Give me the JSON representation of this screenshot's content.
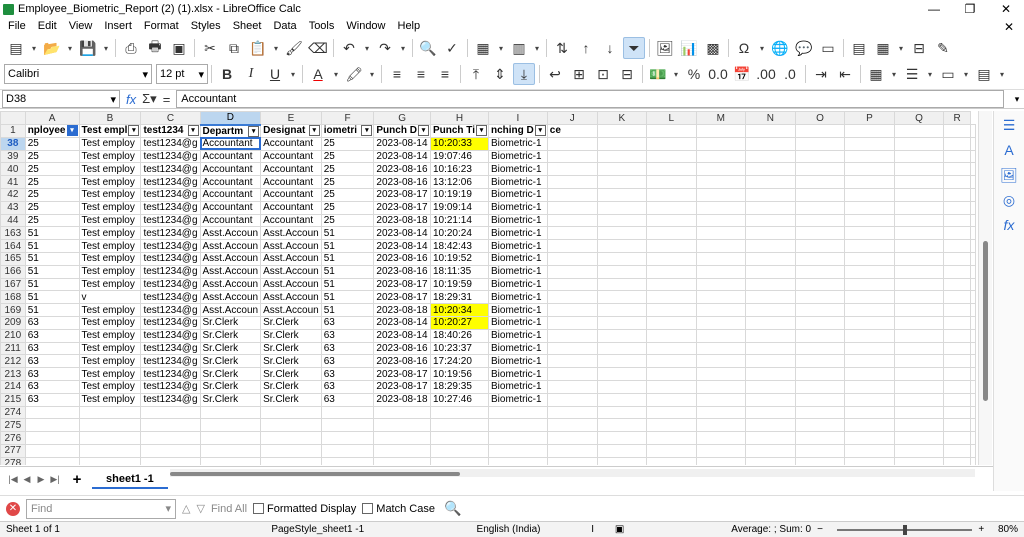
{
  "window": {
    "title": "Employee_Biometric_Report (2) (1).xlsx - LibreOffice Calc"
  },
  "menu": [
    "File",
    "Edit",
    "View",
    "Insert",
    "Format",
    "Styles",
    "Sheet",
    "Data",
    "Tools",
    "Window",
    "Help"
  ],
  "format": {
    "font_name": "Calibri",
    "font_size": "12 pt"
  },
  "formula": {
    "cell_ref": "D38",
    "content": "Accountant"
  },
  "columns": [
    "A",
    "B",
    "C",
    "D",
    "E",
    "F",
    "G",
    "H",
    "I",
    "J",
    "K",
    "L",
    "M",
    "N",
    "O",
    "P",
    "Q",
    "R"
  ],
  "selected_column": "D",
  "header_row": {
    "row_num": "1",
    "cells": [
      "nployee",
      "Test empl",
      "test1234",
      "Departm",
      "Designat",
      "iometri",
      "Punch D",
      "Punch Ti",
      "nching D",
      "ce",
      "",
      "",
      "",
      "",
      "",
      "",
      "",
      ""
    ]
  },
  "rows": [
    {
      "num": "38",
      "cells": [
        "25",
        "Test employ",
        "test1234@g",
        "Accountant",
        "Accountant",
        "25",
        "2023-08-14",
        "10:20:33",
        "Biometric-1"
      ]
    },
    {
      "num": "39",
      "cells": [
        "25",
        "Test employ",
        "test1234@g",
        "Accountant",
        "Accountant",
        "25",
        "2023-08-14",
        "19:07:46",
        "Biometric-1"
      ]
    },
    {
      "num": "40",
      "cells": [
        "25",
        "Test employ",
        "test1234@g",
        "Accountant",
        "Accountant",
        "25",
        "2023-08-16",
        "10:16:23",
        "Biometric-1"
      ]
    },
    {
      "num": "41",
      "cells": [
        "25",
        "Test employ",
        "test1234@g",
        "Accountant",
        "Accountant",
        "25",
        "2023-08-16",
        "13:12:06",
        "Biometric-1"
      ]
    },
    {
      "num": "42",
      "cells": [
        "25",
        "Test employ",
        "test1234@g",
        "Accountant",
        "Accountant",
        "25",
        "2023-08-17",
        "10:19:19",
        "Biometric-1"
      ]
    },
    {
      "num": "43",
      "cells": [
        "25",
        "Test employ",
        "test1234@g",
        "Accountant",
        "Accountant",
        "25",
        "2023-08-17",
        "19:09:14",
        "Biometric-1"
      ]
    },
    {
      "num": "44",
      "cells": [
        "25",
        "Test employ",
        "test1234@g",
        "Accountant",
        "Accountant",
        "25",
        "2023-08-18",
        "10:21:14",
        "Biometric-1"
      ]
    },
    {
      "num": "163",
      "cells": [
        "51",
        "Test employ",
        "test1234@g",
        "Asst.Accoun",
        "Asst.Accoun",
        "51",
        "2023-08-14",
        "10:20:24",
        "Biometric-1"
      ]
    },
    {
      "num": "164",
      "cells": [
        "51",
        "Test employ",
        "test1234@g",
        "Asst.Accoun",
        "Asst.Accoun",
        "51",
        "2023-08-14",
        "18:42:43",
        "Biometric-1"
      ]
    },
    {
      "num": "165",
      "cells": [
        "51",
        "Test employ",
        "test1234@g",
        "Asst.Accoun",
        "Asst.Accoun",
        "51",
        "2023-08-16",
        "10:19:52",
        "Biometric-1"
      ]
    },
    {
      "num": "166",
      "cells": [
        "51",
        "Test employ",
        "test1234@g",
        "Asst.Accoun",
        "Asst.Accoun",
        "51",
        "2023-08-16",
        "18:11:35",
        "Biometric-1"
      ]
    },
    {
      "num": "167",
      "cells": [
        "51",
        "Test employ",
        "test1234@g",
        "Asst.Accoun",
        "Asst.Accoun",
        "51",
        "2023-08-17",
        "10:19:59",
        "Biometric-1"
      ]
    },
    {
      "num": "168",
      "cells": [
        "51",
        "v",
        "test1234@g",
        "Asst.Accoun",
        "Asst.Accoun",
        "51",
        "2023-08-17",
        "18:29:31",
        "Biometric-1"
      ]
    },
    {
      "num": "169",
      "cells": [
        "51",
        "Test employ",
        "test1234@g",
        "Asst.Accoun",
        "Asst.Accoun",
        "51",
        "2023-08-18",
        "10:20:34",
        "Biometric-1"
      ]
    },
    {
      "num": "209",
      "cells": [
        "63",
        "Test employ",
        "test1234@g",
        "Sr.Clerk",
        "Sr.Clerk",
        "63",
        "2023-08-14",
        "10:20:27",
        "Biometric-1"
      ]
    },
    {
      "num": "210",
      "cells": [
        "63",
        "Test employ",
        "test1234@g",
        "Sr.Clerk",
        "Sr.Clerk",
        "63",
        "2023-08-14",
        "18:40:26",
        "Biometric-1"
      ]
    },
    {
      "num": "211",
      "cells": [
        "63",
        "Test employ",
        "test1234@g",
        "Sr.Clerk",
        "Sr.Clerk",
        "63",
        "2023-08-16",
        "10:23:37",
        "Biometric-1"
      ]
    },
    {
      "num": "212",
      "cells": [
        "63",
        "Test employ",
        "test1234@g",
        "Sr.Clerk",
        "Sr.Clerk",
        "63",
        "2023-08-16",
        "17:24:20",
        "Biometric-1"
      ]
    },
    {
      "num": "213",
      "cells": [
        "63",
        "Test employ",
        "test1234@g",
        "Sr.Clerk",
        "Sr.Clerk",
        "63",
        "2023-08-17",
        "10:19:56",
        "Biometric-1"
      ]
    },
    {
      "num": "214",
      "cells": [
        "63",
        "Test employ",
        "test1234@g",
        "Sr.Clerk",
        "Sr.Clerk",
        "63",
        "2023-08-17",
        "18:29:35",
        "Biometric-1"
      ]
    },
    {
      "num": "215",
      "cells": [
        "63",
        "Test employ",
        "test1234@g",
        "Sr.Clerk",
        "Sr.Clerk",
        "63",
        "2023-08-18",
        "10:27:46",
        "Biometric-1"
      ]
    },
    {
      "num": "274",
      "cells": []
    },
    {
      "num": "275",
      "cells": []
    },
    {
      "num": "276",
      "cells": []
    },
    {
      "num": "277",
      "cells": []
    },
    {
      "num": "278",
      "cells": []
    }
  ],
  "highlighted_rows": [
    "38",
    "169",
    "209"
  ],
  "highlight_color": "#ffff00",
  "sheet_tab": "sheet1 -1",
  "find": {
    "placeholder": "Find",
    "find_all": "Find All",
    "formatted_display": "Formatted Display",
    "match_case": "Match Case"
  },
  "status": {
    "sheet": "Sheet 1 of 1",
    "page_style": "PageStyle_sheet1 -1",
    "language": "English (India)",
    "summary": "Average: ; Sum: 0",
    "zoom": "80%"
  }
}
